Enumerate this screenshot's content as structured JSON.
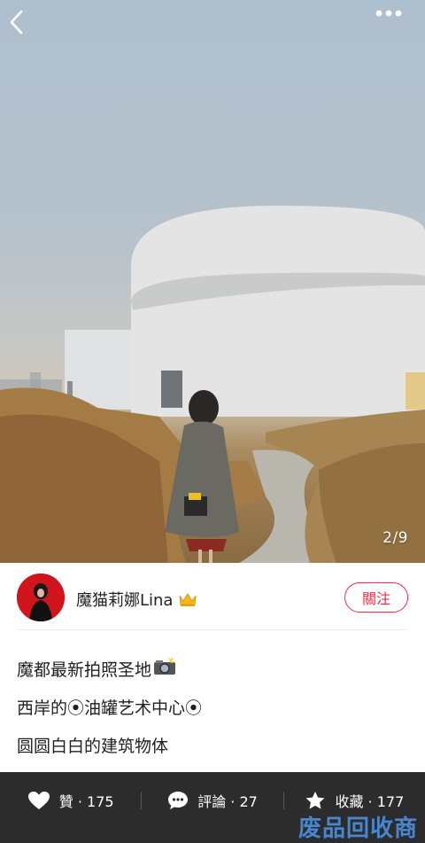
{
  "hero": {
    "counter": "2/9",
    "icons": {
      "back": "chevron-left-icon",
      "more": "more-dots-icon"
    }
  },
  "author": {
    "name": "魔猫莉娜Lina",
    "badge_icon": "crown-icon",
    "follow_label": "關注"
  },
  "post": {
    "lines": [
      {
        "text": "魔都最新拍照圣地",
        "emoji": "📸"
      },
      {
        "text": "西岸的⦿油罐艺术中心⦿"
      },
      {
        "text": "圆圆白白的建筑物体"
      }
    ]
  },
  "actions": [
    {
      "label": "贊 · 175",
      "icon": "heart-icon"
    },
    {
      "label": "評論 · 27",
      "icon": "comment-icon"
    },
    {
      "label": "收藏 · 177",
      "icon": "star-icon"
    }
  ],
  "watermark": "废品回收商",
  "colors": {
    "accent": "#ff2442",
    "bar": "#2c2c2c"
  }
}
